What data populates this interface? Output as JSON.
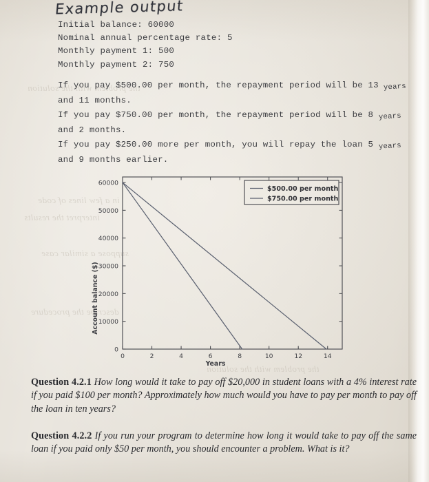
{
  "page": {
    "background_color": "#ebe7df",
    "ink_color": "#3b3c40",
    "handwritten_title": "Example output"
  },
  "program_output": {
    "parameters": [
      "Initial balance: 60000",
      "Nominal annual percentage rate: 5",
      "Monthly payment 1: 500",
      "Monthly payment 2: 750"
    ],
    "results": [
      {
        "head": "If you pay $500.00 per month, the repayment period will be 13 ",
        "tail": "years",
        "next": "and 11 months."
      },
      {
        "head": "If you pay $750.00 per month, the repayment period will be 8 ",
        "tail": "years",
        "next": "and 2 months."
      },
      {
        "head": "If you pay $250.00 more per month, you will repay the loan 5 ",
        "tail": "years",
        "next": "and 9 months earlier."
      }
    ]
  },
  "chart_data": {
    "type": "line",
    "title": "",
    "xlabel": "Years",
    "ylabel": "Account balance ($)",
    "xlim": [
      0,
      15
    ],
    "ylim": [
      0,
      62000
    ],
    "xticks": [
      0,
      2,
      4,
      6,
      8,
      10,
      12,
      14
    ],
    "yticks": [
      0,
      10000,
      20000,
      30000,
      40000,
      50000,
      60000
    ],
    "xtick_labels": [
      "0",
      "2",
      "4",
      "6",
      "8",
      "10",
      "12",
      "14"
    ],
    "ytick_labels": [
      "0",
      "10000",
      "20000",
      "30000",
      "40000",
      "50000",
      "60000"
    ],
    "grid": false,
    "legend_position": "upper right",
    "line_color": "#5b6170",
    "series": [
      {
        "name": "$500.00 per month",
        "x": [
          0,
          13.917
        ],
        "y": [
          60000,
          0
        ]
      },
      {
        "name": "$750.00 per month",
        "x": [
          0,
          8.167
        ],
        "y": [
          60000,
          0
        ]
      }
    ]
  },
  "questions": [
    {
      "label": "Question 4.2.1",
      "text": "How long would it take to pay off $20,000 in student loans with a 4% interest rate if you paid $100 per month? Approximately how much would you have to pay per month to pay off the loan in ten years?"
    },
    {
      "label": "Question 4.2.2",
      "text": "If you run your program to determine how long it would take to pay off the same loan if you paid only $50 per month, you should encounter a problem. What is it?"
    }
  ],
  "bleed_text": [
    "the problem with the solution",
    "in a few lines of code",
    "interpret the results",
    "suppose a similar case",
    "describe the procedure"
  ]
}
